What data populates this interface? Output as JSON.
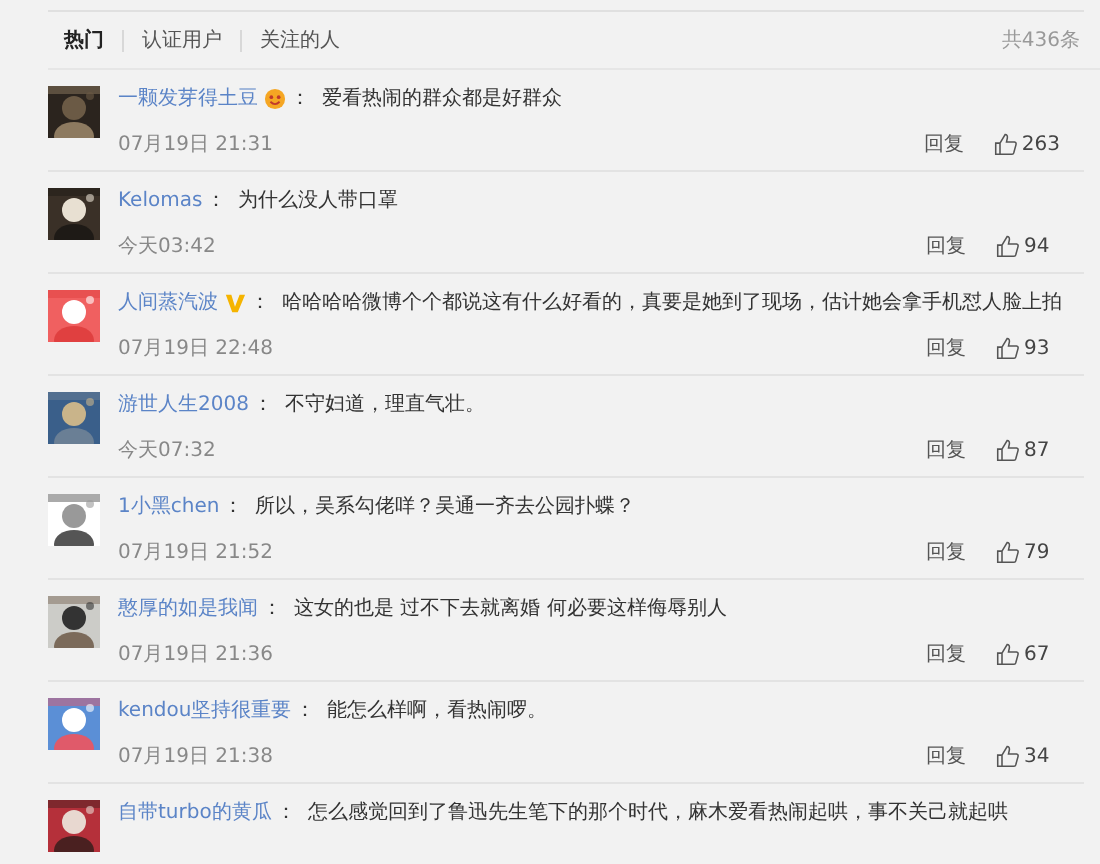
{
  "tabs": [
    {
      "label": "热门",
      "selected": true
    },
    {
      "label": "认证用户",
      "selected": false
    },
    {
      "label": "关注的人",
      "selected": false
    }
  ],
  "total": "共436条",
  "comments": [
    {
      "kind": "emoji",
      "user": "一颗发芽得土豆",
      "separator": "：",
      "text": "爱看热闹的群众都是好群众",
      "time": "07月19日 21:31",
      "reply": "回复",
      "likes": "263"
    },
    {
      "kind": "plain",
      "user": "Kelomas",
      "separator": "：",
      "text": "为什么没人带口罩",
      "time": "今天03:42",
      "reply": "回复",
      "likes": "94"
    },
    {
      "kind": "verified",
      "user": "人间蒸汽波",
      "separator": "：",
      "text": "哈哈哈哈微博个个都说这有什么好看的，真要是她到了现场，估计她会拿手机怼人脸上拍",
      "time": "07月19日 22:48",
      "reply": "回复",
      "likes": "93"
    },
    {
      "kind": "plain",
      "user": "游世人生2008",
      "separator": "：",
      "text": "不守妇道，理直气壮。",
      "time": "今天07:32",
      "reply": "回复",
      "likes": "87"
    },
    {
      "kind": "plain",
      "user": "1小黑chen",
      "separator": "：",
      "text": "所以，吴系勾佬咩？吴通一齐去公园扑蝶？",
      "time": "07月19日 21:52",
      "reply": "回复",
      "likes": "79"
    },
    {
      "kind": "plain",
      "user": "憨厚的如是我闻",
      "separator": "：",
      "text": "这女的也是 过不下去就离婚 何必要这样侮辱别人",
      "time": "07月19日 21:36",
      "reply": "回复",
      "likes": "67"
    },
    {
      "kind": "plain",
      "user": "kendou坚持很重要",
      "separator": "：",
      "text": "能怎么样啊，看热闹啰。",
      "time": "07月19日 21:38",
      "reply": "回复",
      "likes": "34"
    },
    {
      "kind": "plain",
      "user": "自带turbo的黄瓜",
      "separator": "：",
      "text": "怎么感觉回到了鲁迅先生笔下的那个时代，麻木爱看热闹起哄，事不关己就起哄"
    }
  ]
}
